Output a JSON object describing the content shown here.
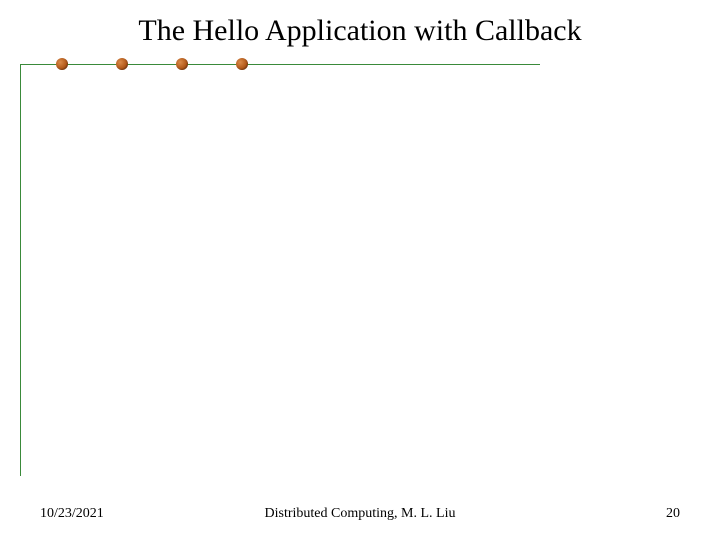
{
  "title": "The Hello Application with Callback",
  "footer": {
    "date": "10/23/2021",
    "center": "Distributed Computing, M. L. Liu",
    "page": "20"
  }
}
